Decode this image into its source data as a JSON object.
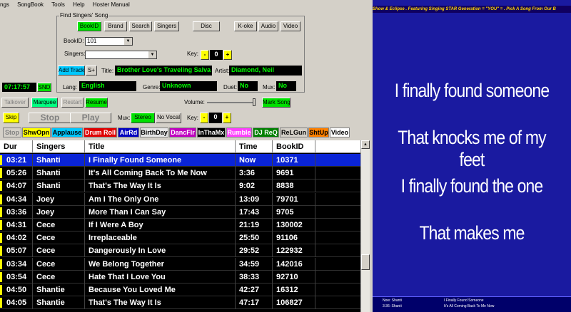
{
  "menu": [
    "ngs",
    "SongBook",
    "Tools",
    "Help",
    "Hoster Manual"
  ],
  "find": {
    "title": "Find Singers' Song",
    "tabs": [
      "BookID",
      "Brand",
      "Search",
      "Singers"
    ],
    "disc": "Disc",
    "modes": [
      "K-oke",
      "Audio",
      "Video"
    ],
    "bookid_label": "BookID:",
    "bookid_value": "101",
    "singers_label": "Singers:",
    "key_label": "Key:",
    "key_minus": "-",
    "key_value": "0",
    "key_plus": "+",
    "add_track": "Add Track",
    "s_plus": "S+",
    "title_label": "Title:",
    "title_value": "Brother Love's Traveling Salva",
    "artist_label": "Artist:",
    "artist_value": "Diamond, Neil",
    "lang_label": "Lang:",
    "lang_value": "English",
    "genre_label": "Genre:",
    "genre_value": "Unknown",
    "duet_label": "Duet:",
    "duet_value": "No",
    "mux_label": "Mux:",
    "mux_value": "No"
  },
  "clock": {
    "time": "07:17:57",
    "snd": "SND"
  },
  "controls": {
    "talkover": "Talkover",
    "marquee": "Marquee",
    "restart": "Restart",
    "resume": "Resume",
    "volume_label": "Volume:",
    "mark_song": "Mark Song",
    "skip": "Skip",
    "stop": "Stop",
    "play": "Play",
    "mux_label": "Mux:",
    "stereo": "Stereo",
    "no_vocal": "No Vocal",
    "key_label": "Key:",
    "key_minus": "-",
    "key_value": "0",
    "key_plus": "+"
  },
  "categories": [
    {
      "label": "Stop",
      "bg": "#d4d0c8",
      "fg": "#808080"
    },
    {
      "label": "ShwOpn",
      "bg": "#ffff00",
      "fg": "#000000"
    },
    {
      "label": "Applause",
      "bg": "#00c8ff",
      "fg": "#000000"
    },
    {
      "label": "Drum Roll",
      "bg": "#e00000",
      "fg": "#ffffff"
    },
    {
      "label": "AirRd",
      "bg": "#0000c0",
      "fg": "#ffffff"
    },
    {
      "label": "BirthDay",
      "bg": "#e8e8e8",
      "fg": "#000000"
    },
    {
      "label": "DancFlr",
      "bg": "#c000c0",
      "fg": "#ffffff"
    },
    {
      "label": "InThaMx",
      "bg": "#000000",
      "fg": "#ffffff"
    },
    {
      "label": "Rumble",
      "bg": "#ff40ff",
      "fg": "#ffffff"
    },
    {
      "label": "DJ ReQ",
      "bg": "#008000",
      "fg": "#ffffff"
    },
    {
      "label": "ReLGun",
      "bg": "#d4d0c8",
      "fg": "#000000"
    },
    {
      "label": "ShtUp",
      "bg": "#ff8000",
      "fg": "#000000"
    },
    {
      "label": "Video",
      "bg": "#ffffff",
      "fg": "#000000"
    }
  ],
  "queue": {
    "headers": [
      "Dur",
      "Singers",
      "Title",
      "Time",
      "BookID"
    ],
    "rows": [
      {
        "dur": "03:21",
        "singer": "Shanti",
        "title": "I Finally Found Someone",
        "time": "Now",
        "bookid": "10371"
      },
      {
        "dur": "05:26",
        "singer": "Shanti",
        "title": "It's All Coming Back To Me Now",
        "time": "3:36",
        "bookid": "9691"
      },
      {
        "dur": "04:07",
        "singer": "Shanti",
        "title": "That's The Way It Is",
        "time": "9:02",
        "bookid": "8838"
      },
      {
        "dur": "04:34",
        "singer": "Joey",
        "title": "Am I The Only One",
        "time": "13:09",
        "bookid": "79701"
      },
      {
        "dur": "03:36",
        "singer": "Joey",
        "title": "More Than I Can Say",
        "time": "17:43",
        "bookid": "9705"
      },
      {
        "dur": "04:31",
        "singer": "Cece",
        "title": "If I Were A Boy",
        "time": "21:19",
        "bookid": "130002"
      },
      {
        "dur": "04:02",
        "singer": "Cece",
        "title": "Irreplaceable",
        "time": "25:50",
        "bookid": "91106"
      },
      {
        "dur": "05:07",
        "singer": "Cece",
        "title": "Dangerously In Love",
        "time": "29:52",
        "bookid": "122932"
      },
      {
        "dur": "03:34",
        "singer": "Cece",
        "title": "We Belong Together",
        "time": "34:59",
        "bookid": "142016"
      },
      {
        "dur": "03:54",
        "singer": "Cece",
        "title": "Hate That I Love You",
        "time": "38:33",
        "bookid": "92710"
      },
      {
        "dur": "04:50",
        "singer": "Shantie",
        "title": "Because You Loved Me",
        "time": "42:27",
        "bookid": "16312"
      },
      {
        "dur": "04:05",
        "singer": "Shantie",
        "title": "That's The Way It Is",
        "time": "47:17",
        "bookid": "106827"
      }
    ]
  },
  "marquee": "Show & Eclipse   .   Featuring Singing STAR Generation = \"YOU\" =   .   Pick A Song From Our B",
  "lyrics": [
    "I finally found someone",
    "That knocks me of my feet",
    "I finally found the one",
    "That makes me"
  ],
  "footer": {
    "now_label": "Now: Shanti",
    "now_title": "I Finally Found Someone",
    "next_label": "3:36: Shanti",
    "next_title": "It's All Coming Back To Me Now"
  }
}
